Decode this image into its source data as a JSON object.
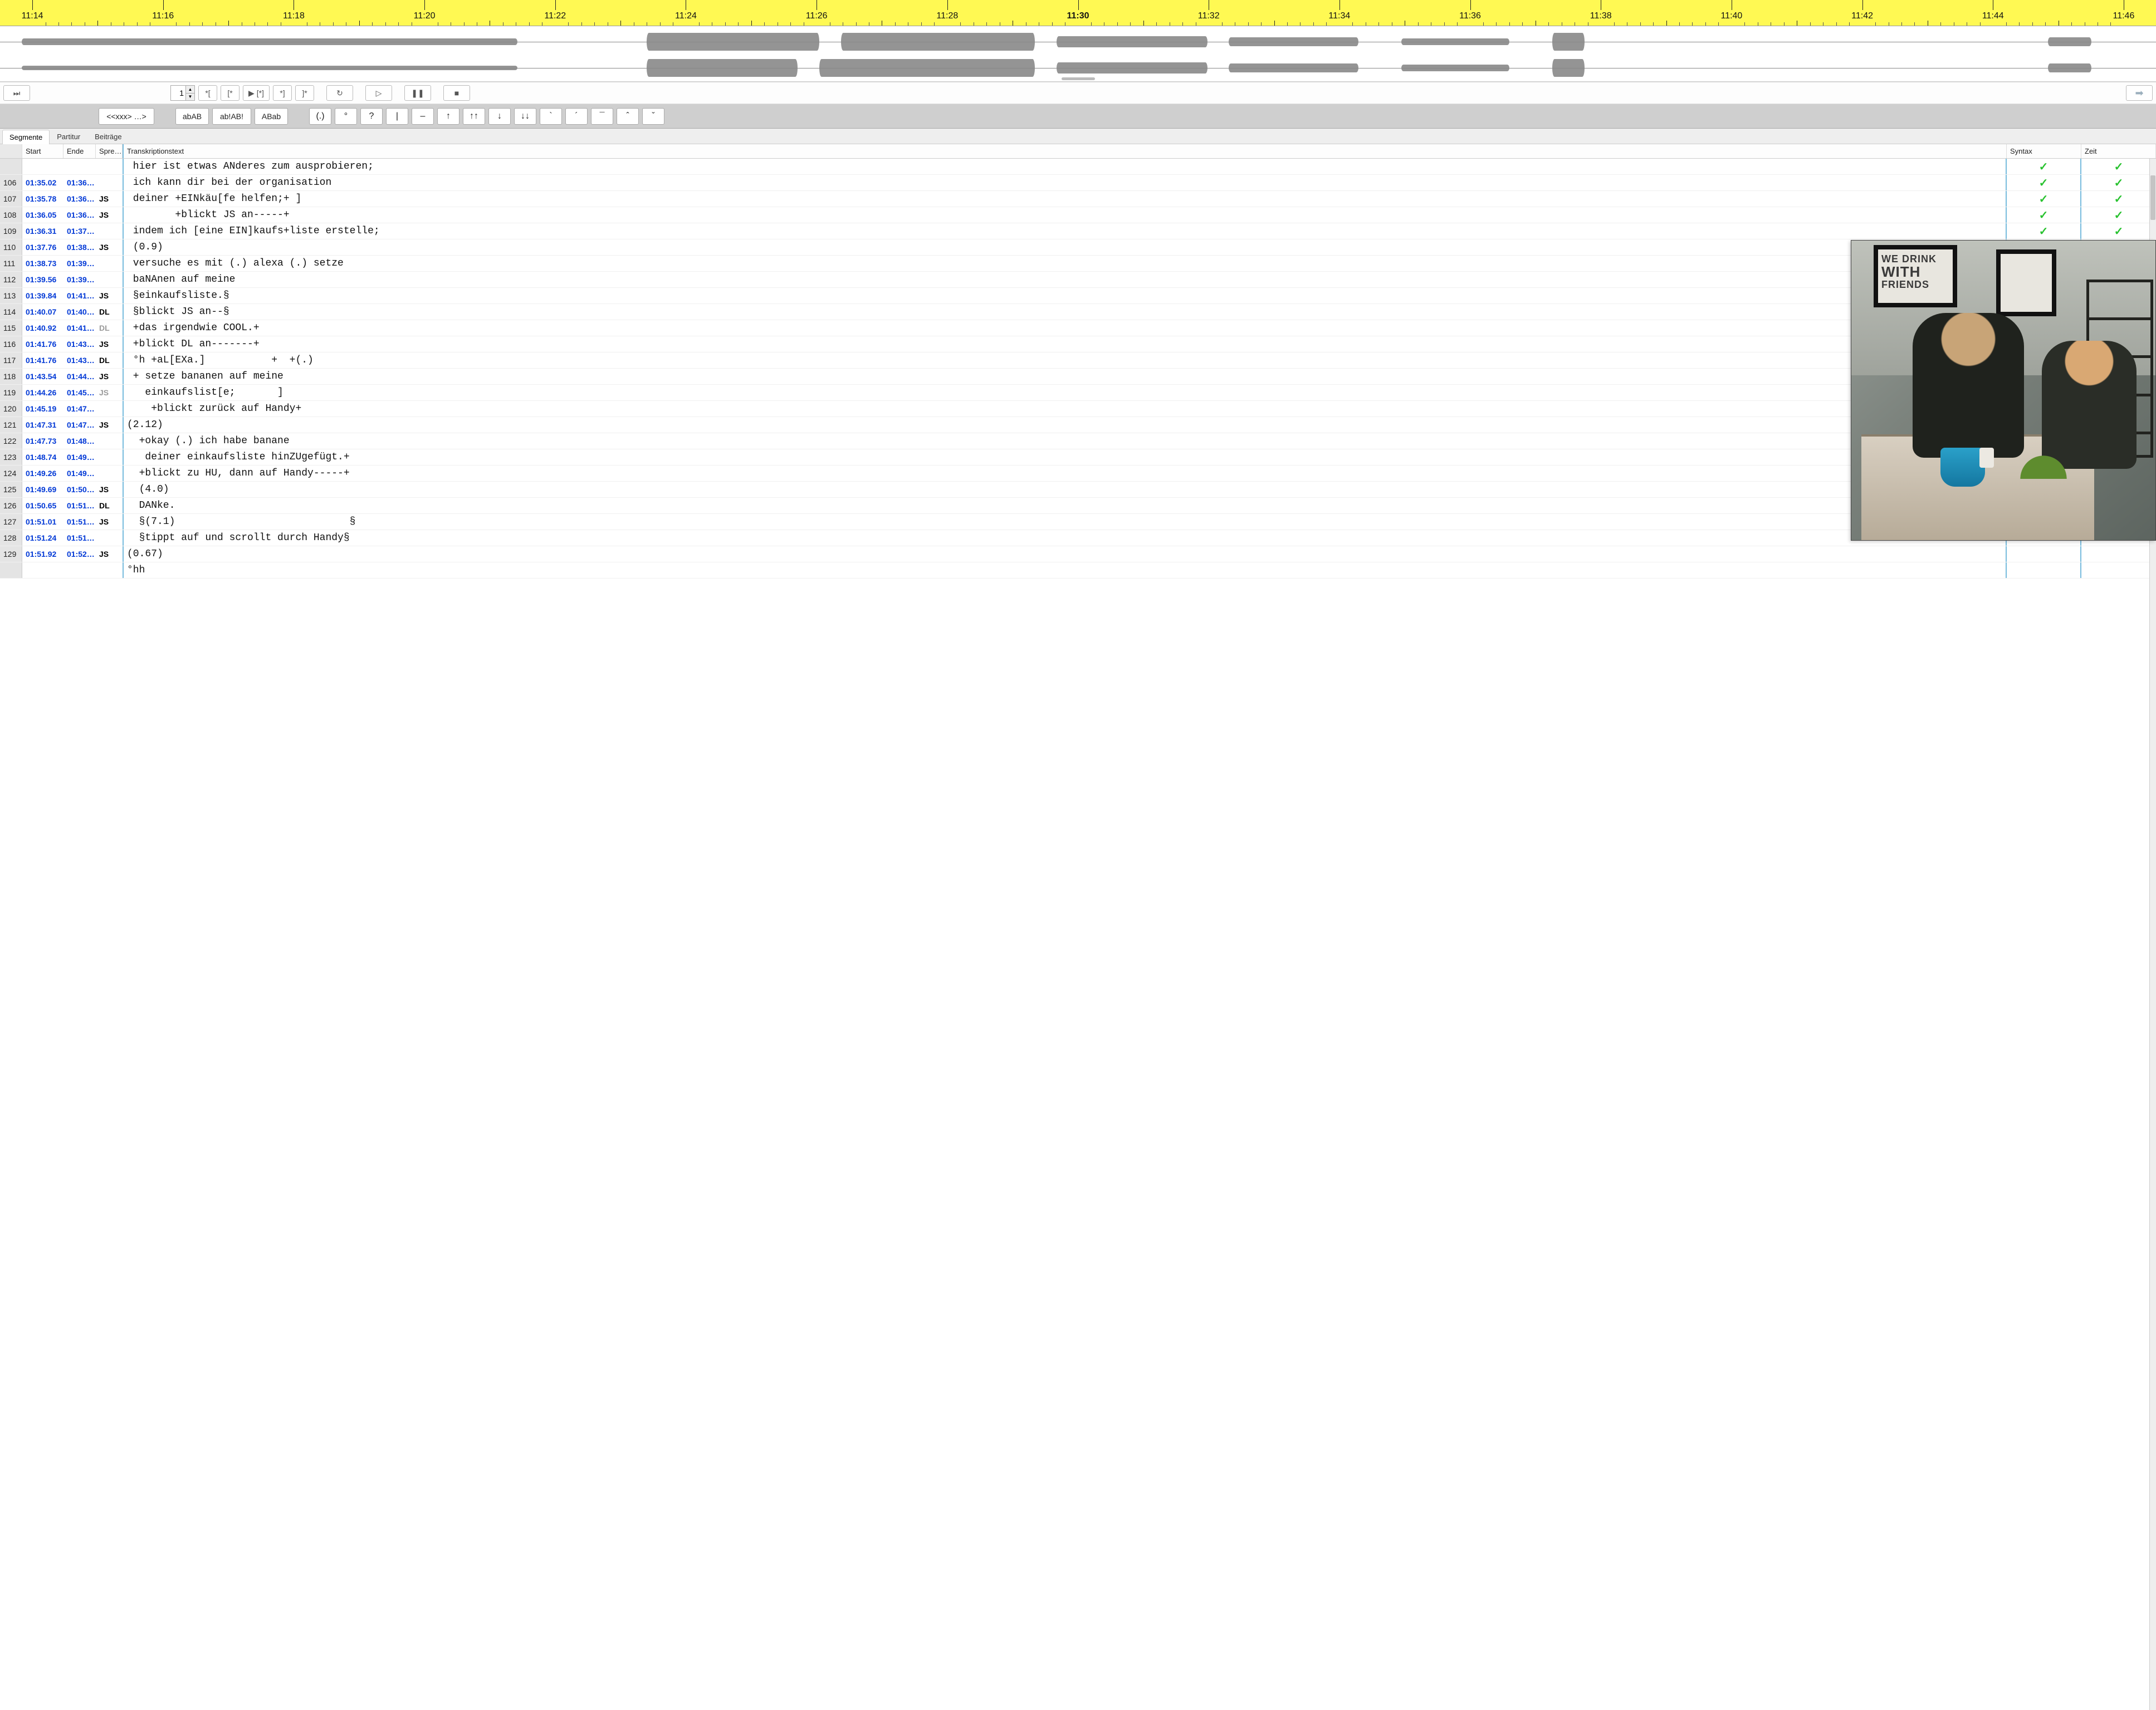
{
  "timeline": {
    "labels": [
      "11:14",
      "11:16",
      "11:18",
      "11:20",
      "11:22",
      "11:24",
      "11:26",
      "11:28",
      "11:30",
      "11:32",
      "11:34",
      "11:36",
      "11:38",
      "11:40",
      "11:42",
      "11:44",
      "11:46"
    ],
    "bold_index": 8
  },
  "transport": {
    "skip_icon": "⏭",
    "spinner_value": "1",
    "btn_star_open": "*[",
    "btn_open_star": "[*",
    "btn_play_star": "▶ [*]",
    "btn_star_close": "*]",
    "btn_close_star": "]*",
    "btn_refresh": "↻",
    "btn_play": "▷",
    "btn_pause": "❚❚",
    "btn_stop": "■",
    "btn_forward": "➡"
  },
  "editbar": {
    "xxx": "<<xxx> …>",
    "abAB": "abAB",
    "abEXAB": "ab!AB!",
    "ABab": "ABab",
    "dot": "(.)",
    "deg": "°",
    "q": "?",
    "pipe": "|",
    "dash": "–",
    "up": "↑",
    "upup": "↑↑",
    "down": "↓",
    "downdown": "↓↓",
    "grave": "`",
    "acute": "´",
    "macron": "¯",
    "caret": "ˆ",
    "hacek": "ˇ"
  },
  "tabs": {
    "t0": "Segmente",
    "t1": "Partitur",
    "t2": "Beiträge",
    "active": 0
  },
  "headers": {
    "num": "",
    "start": "Start",
    "end": "Ende",
    "speaker": "Spre…",
    "text": "Transkriptionstext",
    "syntax": "Syntax",
    "zeit": "Zeit"
  },
  "segments": [
    {
      "n": "",
      "start": "",
      "end": "",
      "spk": "",
      "text": "hier ist etwas ANderes zum ausprobieren;",
      "syn": true,
      "zeit": true
    },
    {
      "n": "106",
      "start": "01:35.02",
      "end": "01:36…",
      "spk": "",
      "text": "ich kann dir bei der organisation",
      "syn": true,
      "zeit": true
    },
    {
      "n": "107",
      "start": "01:35.78",
      "end": "01:36…",
      "spk": "JS",
      "text": "deiner +EINkäu[fe helfen;+ ]",
      "syn": true,
      "zeit": true
    },
    {
      "n": "108",
      "start": "01:36.05",
      "end": "01:36…",
      "spk": "JS",
      "text": "       +blickt JS an-----+",
      "syn": true,
      "zeit": true
    },
    {
      "n": "109",
      "start": "01:36.31",
      "end": "01:37…",
      "spk": "",
      "text": "indem ich [eine EIN]kaufs+liste erstelle;",
      "syn": true,
      "zeit": true
    },
    {
      "n": "110",
      "start": "01:37.76",
      "end": "01:38…",
      "spk": "JS",
      "text": "(0.9)",
      "syn": false,
      "zeit": false
    },
    {
      "n": "111",
      "start": "01:38.73",
      "end": "01:39…",
      "spk": "",
      "text": "versuche es mit (.) alexa (.) setze",
      "syn": false,
      "zeit": false
    },
    {
      "n": "112",
      "start": "01:39.56",
      "end": "01:39…",
      "spk": "",
      "text": "baNAnen auf meine",
      "syn": false,
      "zeit": false
    },
    {
      "n": "113",
      "start": "01:39.84",
      "end": "01:41…",
      "spk": "JS",
      "text": "§einkaufsliste.§",
      "syn": false,
      "zeit": false
    },
    {
      "n": "114",
      "start": "01:40.07",
      "end": "01:40…",
      "spk": "DL",
      "text": "§blickt JS an--§",
      "syn": false,
      "zeit": false
    },
    {
      "n": "115",
      "start": "01:40.92",
      "end": "01:41…",
      "spk": "DL",
      "dim": true,
      "text": "+das irgendwie COOL.+",
      "syn": false,
      "zeit": false
    },
    {
      "n": "116",
      "start": "01:41.76",
      "end": "01:43…",
      "spk": "JS",
      "text": "+blickt DL an-------+",
      "syn": false,
      "zeit": false
    },
    {
      "n": "117",
      "start": "01:41.76",
      "end": "01:43…",
      "spk": "DL",
      "text": "°h +aL[EXa.]           +  +(.)",
      "syn": false,
      "zeit": false
    },
    {
      "n": "118",
      "start": "01:43.54",
      "end": "01:44…",
      "spk": "JS",
      "text": "+ setze bananen auf meine",
      "syn": false,
      "zeit": false
    },
    {
      "n": "119",
      "start": "01:44.26",
      "end": "01:45…",
      "spk": "JS",
      "dim": true,
      "text": "  einkaufslist[e;       ]",
      "syn": false,
      "zeit": false
    },
    {
      "n": "120",
      "start": "01:45.19",
      "end": "01:47…",
      "spk": "",
      "text": "   +blickt zurück auf Handy+",
      "syn": false,
      "zeit": false
    },
    {
      "n": "121",
      "start": "01:47.31",
      "end": "01:47…",
      "spk": "JS",
      "text": "(2.12)",
      "syn": false,
      "zeit": false,
      "shift": -1
    },
    {
      "n": "122",
      "start": "01:47.73",
      "end": "01:48…",
      "spk": "",
      "text": " +okay (.) ich habe banane",
      "syn": false,
      "zeit": false
    },
    {
      "n": "123",
      "start": "01:48.74",
      "end": "01:49…",
      "spk": "",
      "text": "  deiner einkaufsliste hinZUgefügt.+",
      "syn": false,
      "zeit": false
    },
    {
      "n": "124",
      "start": "01:49.26",
      "end": "01:49…",
      "spk": "",
      "text": " +blickt zu HU, dann auf Handy-----+",
      "syn": false,
      "zeit": false
    },
    {
      "n": "125",
      "start": "01:49.69",
      "end": "01:50…",
      "spk": "JS",
      "text": " (4.0)",
      "syn": false,
      "zeit": false
    },
    {
      "n": "126",
      "start": "01:50.65",
      "end": "01:51…",
      "spk": "DL",
      "text": " DANke.",
      "syn": false,
      "zeit": false
    },
    {
      "n": "127",
      "start": "01:51.01",
      "end": "01:51…",
      "spk": "JS",
      "text": " §(7.1)                             §",
      "syn": false,
      "zeit": false
    },
    {
      "n": "128",
      "start": "01:51.24",
      "end": "01:51…",
      "spk": "",
      "text": " §tippt auf und scrollt durch Handy§",
      "syn": false,
      "zeit": false
    },
    {
      "n": "129",
      "start": "01:51.92",
      "end": "01:52…",
      "spk": "JS",
      "text": "(0.67)",
      "syn": false,
      "zeit": false,
      "shift": -1
    },
    {
      "n": "",
      "start": "",
      "end": "",
      "spk": "",
      "text": "°hh",
      "syn": false,
      "zeit": false,
      "shift": -1
    }
  ],
  "poster_text": {
    "l1": "WE DRINK",
    "l2": "WITH",
    "l3": "FRIENDS"
  }
}
